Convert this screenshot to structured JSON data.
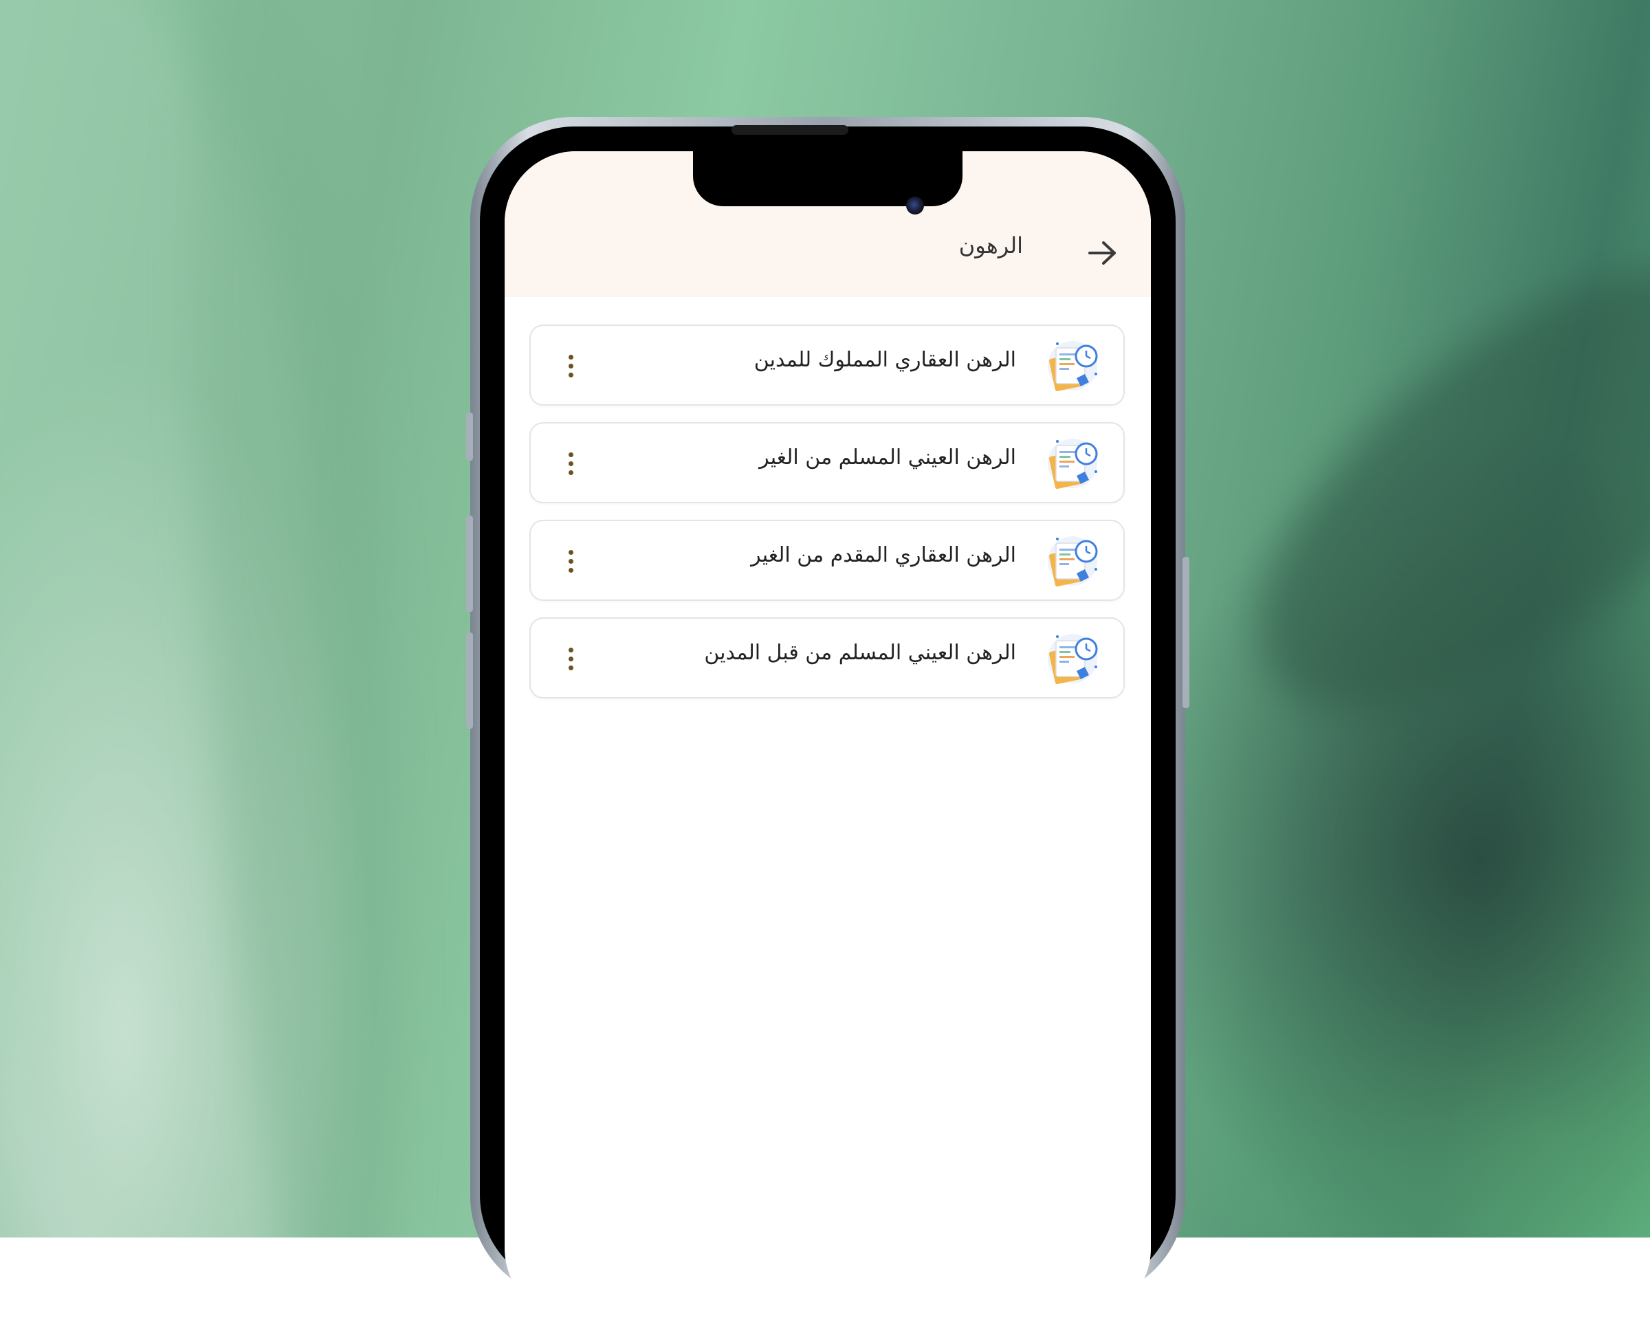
{
  "header": {
    "title": "الرهون",
    "back_icon": "arrow-right-icon"
  },
  "items": [
    {
      "label": "الرهن العقاري المملوك للمدين",
      "icon": "document-clock-icon",
      "menu_icon": "more-vertical-icon"
    },
    {
      "label": "الرهن العيني المسلم من الغير",
      "icon": "document-clock-icon",
      "menu_icon": "more-vertical-icon"
    },
    {
      "label": "الرهن العقاري المقدم من الغير",
      "icon": "document-clock-icon",
      "menu_icon": "more-vertical-icon"
    },
    {
      "label": "الرهن العيني المسلم من قبل المدين",
      "icon": "document-clock-icon",
      "menu_icon": "more-vertical-icon"
    }
  ],
  "colors": {
    "header_bg": "#fdf6f0",
    "menu_dots": "#6b5320",
    "card_border": "#e4e4e4"
  }
}
